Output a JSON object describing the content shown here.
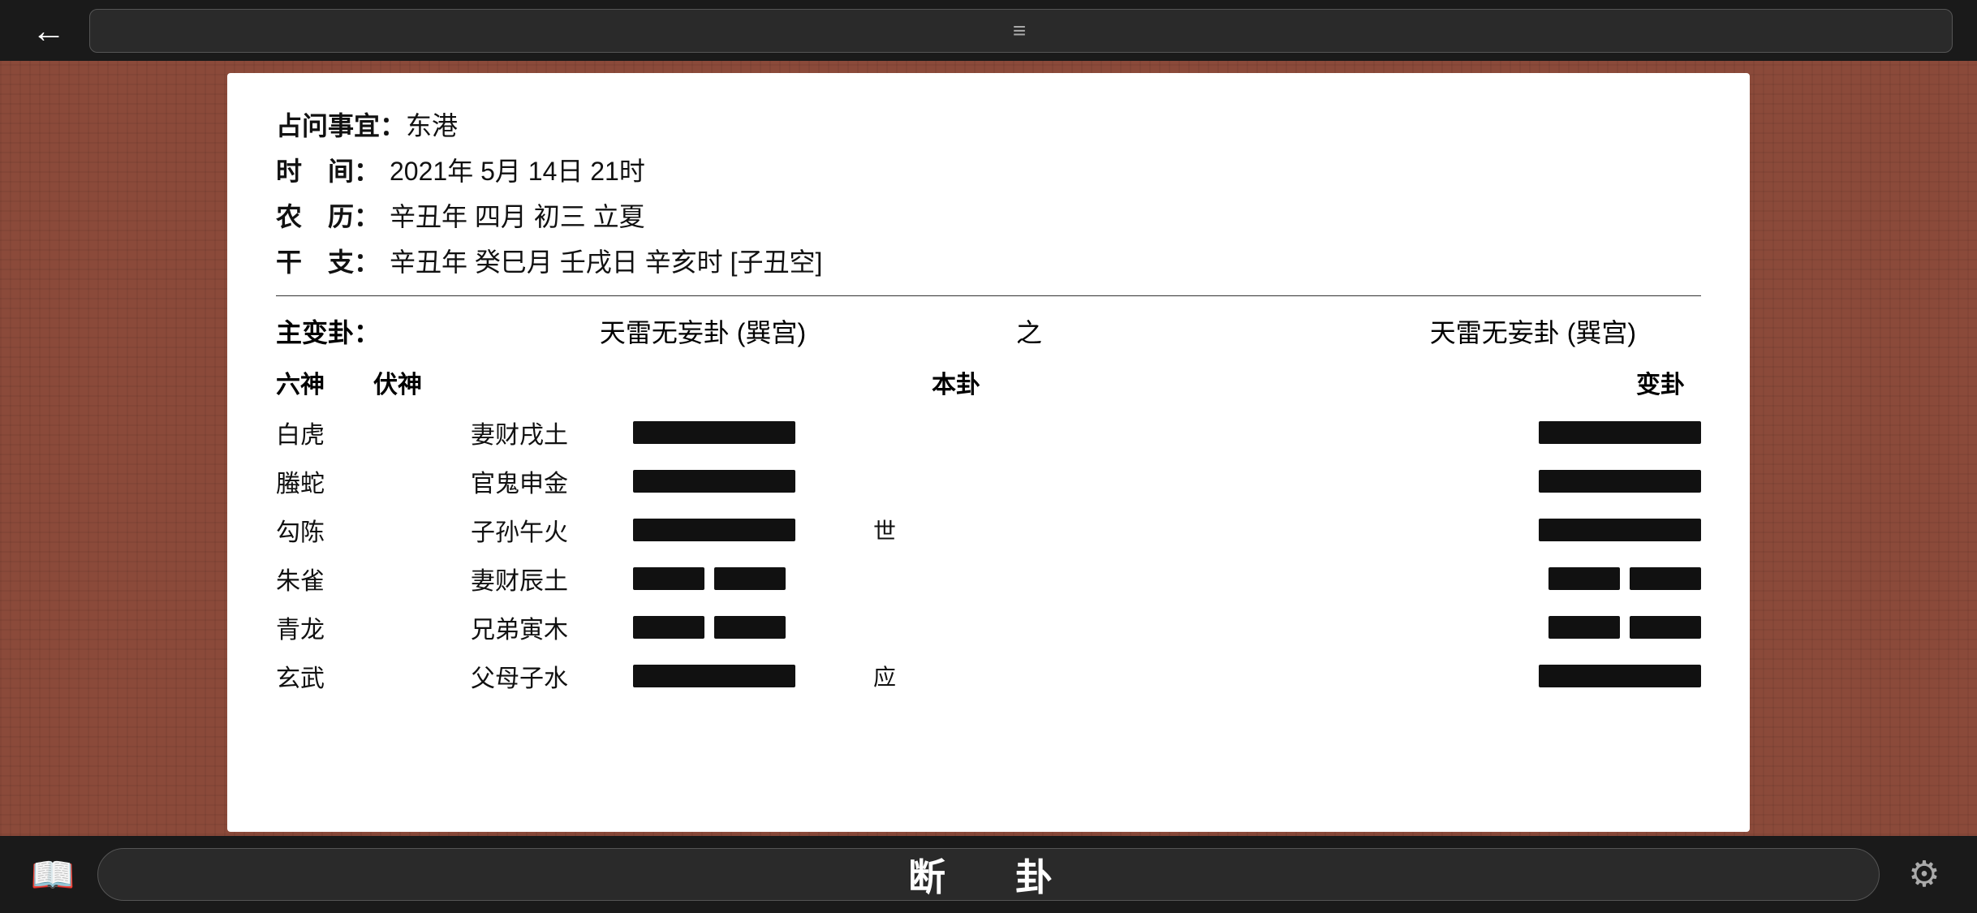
{
  "topBar": {
    "backLabel": "←",
    "hamburgerLabel": "≡"
  },
  "card": {
    "info": {
      "rows": [
        {
          "label": "占问事宜：",
          "value": "东港"
        },
        {
          "label": "时　间：",
          "value": "2021年 5月 14日 21时"
        },
        {
          "label": "农　历：",
          "value": "辛丑年 四月 初三 立夏"
        },
        {
          "label": "干　支：",
          "value": "辛丑年 癸巳月 壬戌日 辛亥时 [子丑空]"
        }
      ]
    },
    "hexagram": {
      "mainLabel": "主变卦：",
      "mainTitle": "天雷无妄卦 (巽宫)",
      "zhi": "之",
      "bianTitle": "天雷无妄卦 (巽宫)",
      "columns": {
        "liushen": "六神",
        "fushen": "伏神",
        "bengua": "本卦",
        "biangua": "变卦"
      },
      "rows": [
        {
          "liushen": "白虎",
          "fushen": "",
          "yaoName": "妻财戌土",
          "benLineType": "solid",
          "marker": "",
          "bianLineType": "solid"
        },
        {
          "liushen": "螣蛇",
          "fushen": "",
          "yaoName": "官鬼申金",
          "benLineType": "solid",
          "marker": "",
          "bianLineType": "solid"
        },
        {
          "liushen": "勾陈",
          "fushen": "",
          "yaoName": "子孙午火",
          "benLineType": "solid",
          "marker": "世",
          "bianLineType": "solid"
        },
        {
          "liushen": "朱雀",
          "fushen": "",
          "yaoName": "妻财辰土",
          "benLineType": "broken",
          "marker": "",
          "bianLineType": "broken"
        },
        {
          "liushen": "青龙",
          "fushen": "",
          "yaoName": "兄弟寅木",
          "benLineType": "broken",
          "marker": "",
          "bianLineType": "broken"
        },
        {
          "liushen": "玄武",
          "fushen": "",
          "yaoName": "父母子水",
          "benLineType": "solid",
          "marker": "应",
          "bianLineType": "solid"
        }
      ]
    }
  },
  "bottomBar": {
    "bookIcon": "📖",
    "centerText": "断　卦",
    "gearIcon": "⚙"
  }
}
